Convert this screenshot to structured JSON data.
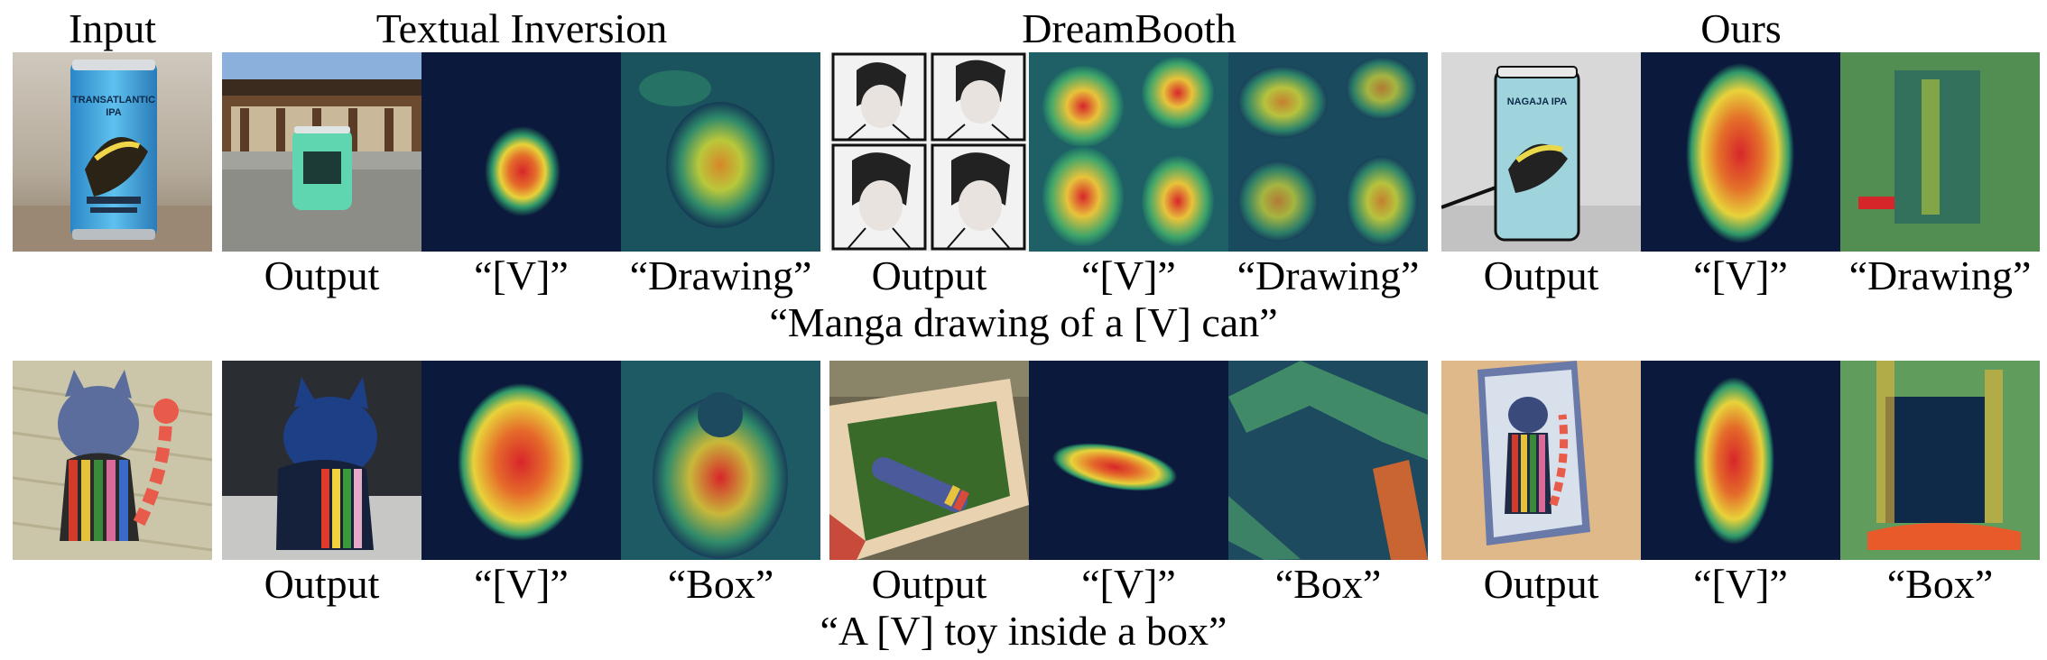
{
  "headers": {
    "input": "Input",
    "textual_inversion": "Textual Inversion",
    "dreambooth": "DreamBooth",
    "ours": "Ours"
  },
  "rows": [
    {
      "prompt": "“Manga drawing of a [V] can”",
      "captions": {
        "output": "Output",
        "token": "“[V]”",
        "word": "“Drawing”"
      },
      "can_text_line1": "TRANSATLANTIC",
      "can_text_line2": "IPA",
      "can_text_manga": "NAGAJA IPA"
    },
    {
      "prompt": "“A [V] toy inside a box”",
      "captions": {
        "output": "Output",
        "token": "“[V]”",
        "word": "“Box”"
      }
    }
  ],
  "colors": {
    "heat_low": "#0b1a3c",
    "heat_mid": "#2f9a6a",
    "heat_high": "#e8d23a",
    "heat_peak": "#d7262a"
  }
}
